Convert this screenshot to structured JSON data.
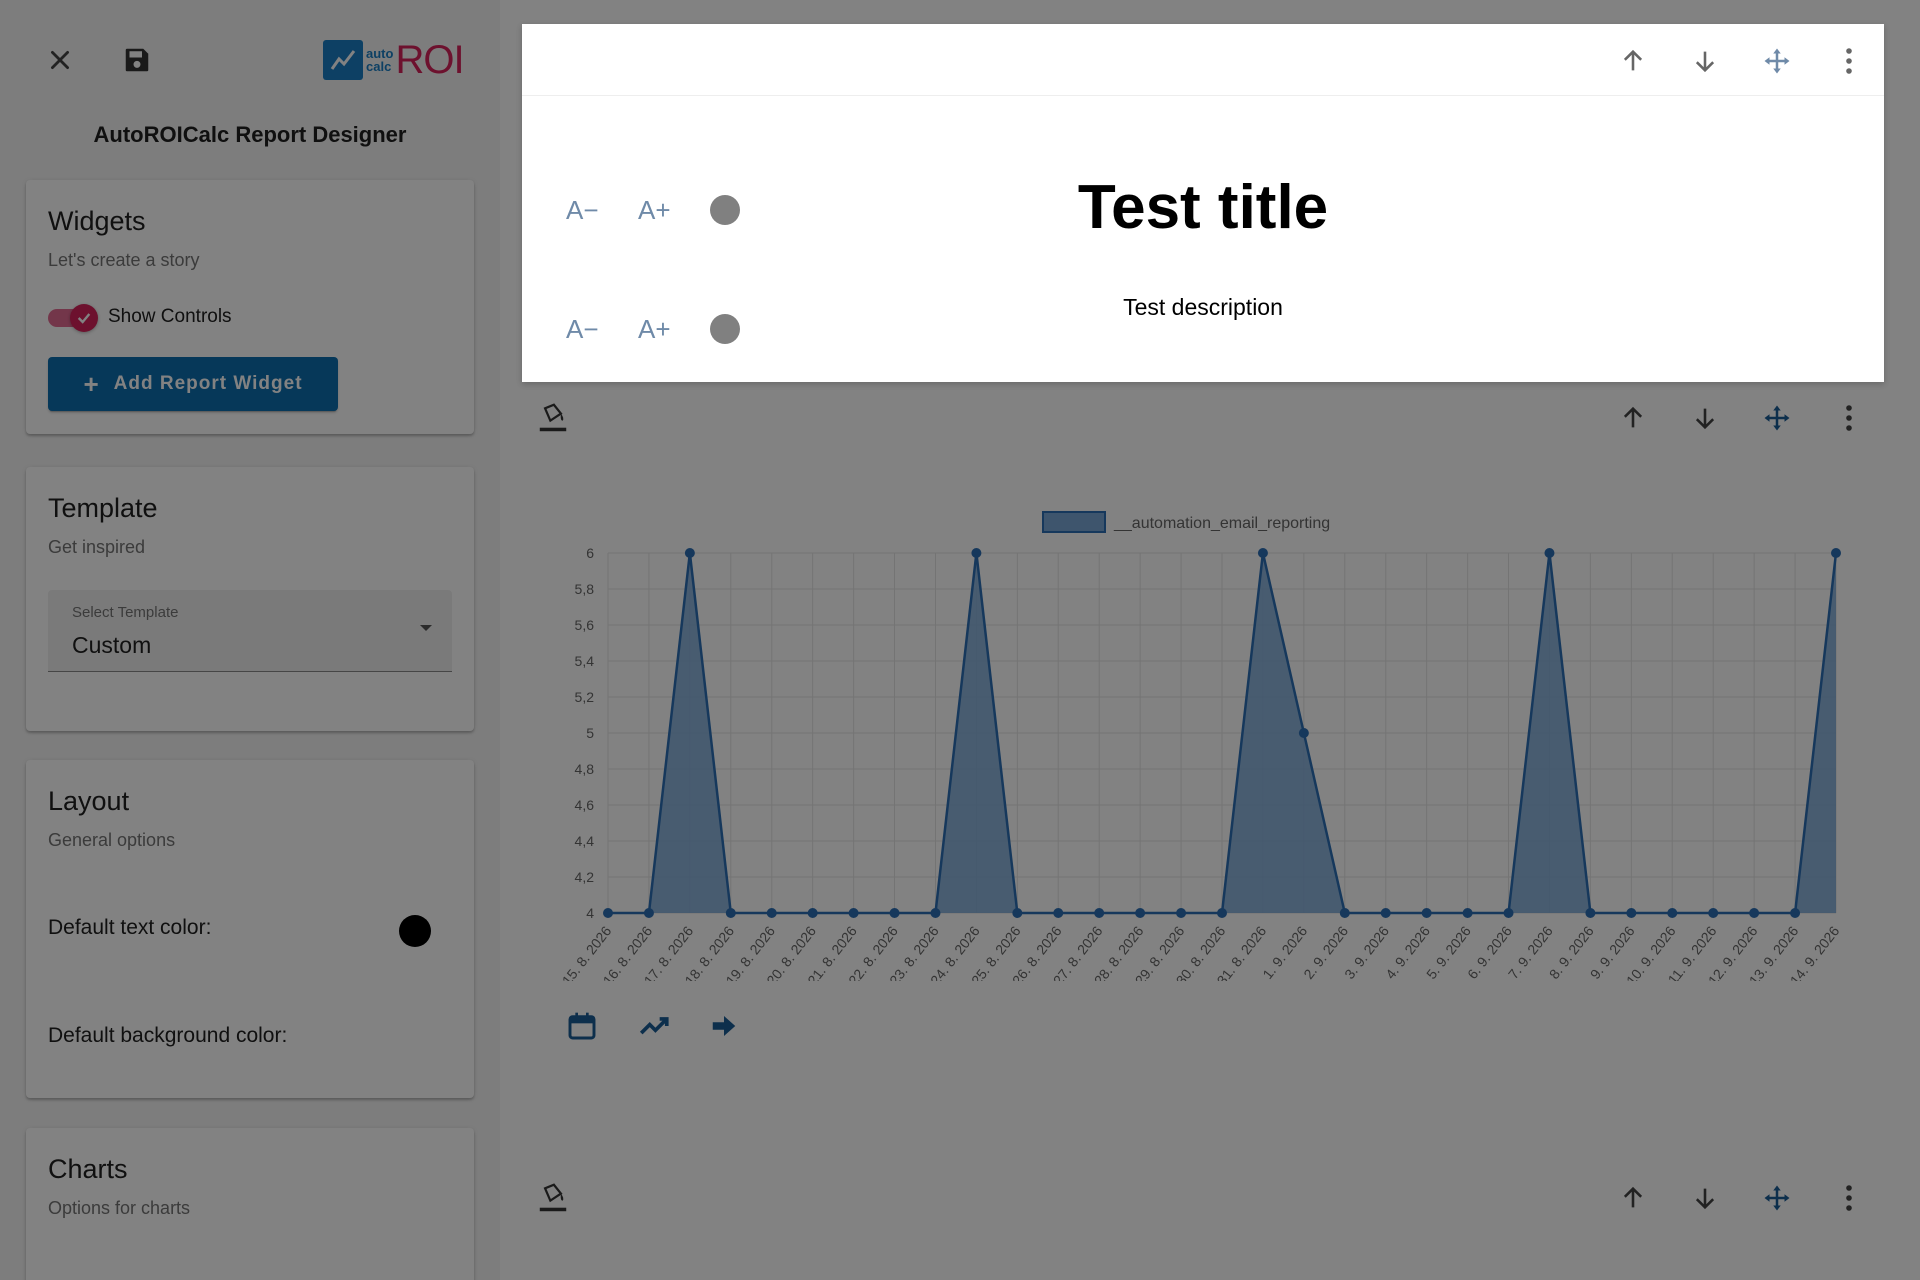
{
  "app": {
    "title": "AutoROICalc Report Designer",
    "logo": {
      "small_top": "auto",
      "small_bottom": "calc",
      "big": "ROI"
    }
  },
  "sidebar": {
    "widgets": {
      "title": "Widgets",
      "subtitle": "Let's create a story",
      "toggle_label": "Show Controls",
      "toggle_on": true,
      "add_button": "Add Report Widget"
    },
    "template": {
      "title": "Template",
      "subtitle": "Get inspired",
      "select_label": "Select Template",
      "select_value": "Custom"
    },
    "layout": {
      "title": "Layout",
      "subtitle": "General options",
      "text_color_label": "Default text color:",
      "text_color": "#000000",
      "bg_color_label": "Default background color:"
    },
    "charts": {
      "title": "Charts",
      "subtitle": "Options for charts"
    }
  },
  "report": {
    "title": "Test title",
    "description": "Test description",
    "font_controls": {
      "decrease": "A−",
      "increase": "A+"
    }
  },
  "colors": {
    "accent": "#d6235a",
    "primary": "#0d6eaf",
    "chart_fill": "#7aa7d6",
    "chart_line": "#2c6fb4",
    "icon_muted": "#6f8aa8"
  },
  "chart_data": {
    "type": "area",
    "series": [
      {
        "name": "__automation_email_reporting",
        "values": [
          4,
          4,
          6,
          4,
          4,
          4,
          4,
          4,
          4,
          6,
          4,
          4,
          4,
          4,
          4,
          4,
          6,
          5,
          4,
          4,
          4,
          4,
          4,
          6,
          4,
          4,
          4,
          4,
          4,
          4,
          6
        ]
      }
    ],
    "categories": [
      "15. 8. 2026",
      "16. 8. 2026",
      "17. 8. 2026",
      "18. 8. 2026",
      "19. 8. 2026",
      "20. 8. 2026",
      "21. 8. 2026",
      "22. 8. 2026",
      "23. 8. 2026",
      "24. 8. 2026",
      "25. 8. 2026",
      "26. 8. 2026",
      "27. 8. 2026",
      "28. 8. 2026",
      "29. 8. 2026",
      "30. 8. 2026",
      "31. 8. 2026",
      "1. 9. 2026",
      "2. 9. 2026",
      "3. 9. 2026",
      "4. 9. 2026",
      "5. 9. 2026",
      "6. 9. 2026",
      "7. 9. 2026",
      "8. 9. 2026",
      "9. 9. 2026",
      "10. 9. 2026",
      "11. 9. 2026",
      "12. 9. 2026",
      "13. 9. 2026",
      "14. 9. 2026"
    ],
    "y_ticks": [
      "4",
      "4,2",
      "4,4",
      "4,6",
      "4,8",
      "5",
      "5,2",
      "5,4",
      "5,6",
      "5,8",
      "6"
    ],
    "ylim": [
      4,
      6
    ],
    "grid": true,
    "legend": "top"
  }
}
